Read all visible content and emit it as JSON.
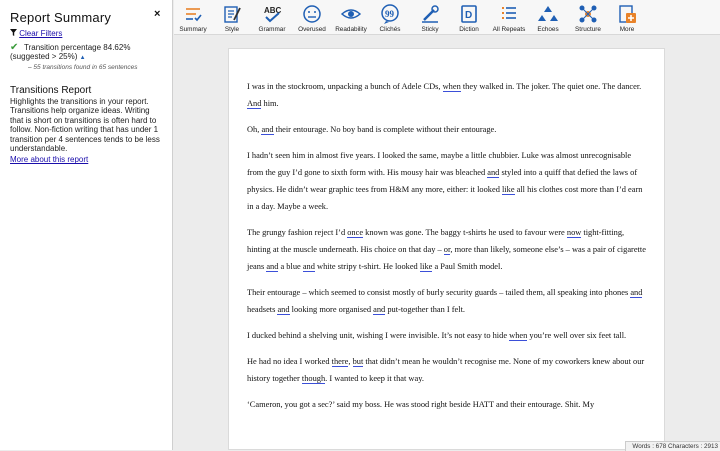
{
  "sidebar": {
    "title": "Report Summary",
    "close": "×",
    "filter_label": "Clear Filters",
    "result": "Transition percentage 84.62% (suggested > 25%)",
    "result_arrow": "▲",
    "result_note": "– 55 transitions found in 65 sentences",
    "heading": "Transitions Report",
    "description": "Highlights the transitions in your report. Transitions help organize ideas. Writing that is short on transitions is often hard to follow. Non-fiction writing that has under 1 transition per 4 sentences tends to be less understandable.",
    "more_link": "More about this report"
  },
  "toolbar": {
    "items": [
      {
        "label": "Summary",
        "icon": "summary-icon"
      },
      {
        "label": "Style",
        "icon": "style-icon"
      },
      {
        "label": "Grammar",
        "icon": "grammar-icon"
      },
      {
        "label": "Overused",
        "icon": "overused-icon"
      },
      {
        "label": "Readability",
        "icon": "readability-icon"
      },
      {
        "label": "Clichés",
        "icon": "cliches-icon"
      },
      {
        "label": "Sticky",
        "icon": "sticky-icon"
      },
      {
        "label": "Diction",
        "icon": "diction-icon"
      },
      {
        "label": "All Repeats",
        "icon": "all-repeats-icon"
      },
      {
        "label": "Echoes",
        "icon": "echoes-icon"
      },
      {
        "label": "Structure",
        "icon": "structure-icon"
      },
      {
        "label": "More",
        "icon": "more-icon"
      }
    ]
  },
  "document": {
    "paragraphs": [
      [
        [
          "I was in the stockroom, unpacking a bunch of Adele CDs, ",
          0
        ],
        [
          "when",
          1
        ],
        [
          " they walked in. The joker. The quiet one. The dancer. ",
          0
        ],
        [
          "And",
          1
        ],
        [
          " him.",
          0
        ]
      ],
      [
        [
          "Oh, ",
          0
        ],
        [
          "and",
          1
        ],
        [
          " their entourage. No boy band is complete without their entourage.",
          0
        ]
      ],
      [
        [
          "I hadn’t seen him in almost five years. I looked the same, maybe a little chubbier. Luke was almost unrecognisable from the guy I’d gone to sixth form with. His mousy hair was bleached ",
          0
        ],
        [
          "and",
          1
        ],
        [
          " styled into a quiff that defied the laws of physics. He didn’t wear graphic tees from H&M any more, either: it looked ",
          0
        ],
        [
          "like",
          1
        ],
        [
          " all his clothes cost more than I’d earn in a day. Maybe a week.",
          0
        ]
      ],
      [
        [
          "The grungy fashion reject I’d ",
          0
        ],
        [
          "once",
          1
        ],
        [
          " known was gone. The baggy t-shirts he used to favour were ",
          0
        ],
        [
          "now",
          1
        ],
        [
          " tight-fitting, hinting at the muscle underneath. His choice on that day – ",
          0
        ],
        [
          "or",
          1
        ],
        [
          ", more than likely, someone else’s – was a pair of cigarette jeans ",
          0
        ],
        [
          "and",
          1
        ],
        [
          " a blue ",
          0
        ],
        [
          "and",
          1
        ],
        [
          " white stripy t-shirt. He looked ",
          0
        ],
        [
          "like",
          1
        ],
        [
          " a Paul Smith model.",
          0
        ]
      ],
      [
        [
          "Their entourage – which seemed to consist mostly of burly security guards – tailed them, all speaking into phones ",
          0
        ],
        [
          "and",
          1
        ],
        [
          " headsets ",
          0
        ],
        [
          "and",
          1
        ],
        [
          " looking more organised ",
          0
        ],
        [
          "and",
          1
        ],
        [
          " put-together than I felt.",
          0
        ]
      ],
      [
        [
          "I ducked behind a shelving unit, wishing I were invisible. It’s not easy to hide ",
          0
        ],
        [
          "when",
          1
        ],
        [
          " you’re well over six feet tall.",
          0
        ]
      ],
      [
        [
          "He had no idea I worked ",
          0
        ],
        [
          "there",
          1
        ],
        [
          ", ",
          0
        ],
        [
          "but",
          1
        ],
        [
          " that didn’t mean he wouldn’t recognise me. None of my coworkers knew about our history together ",
          0
        ],
        [
          "though",
          1
        ],
        [
          ". I wanted to keep it that way.",
          0
        ]
      ],
      [
        [
          "‘Cameron, you got a sec?’ said my boss. He was stood right beside HATT and their entourage. Shit. My",
          0
        ]
      ]
    ]
  },
  "status": "Words : 678 Characters : 2913",
  "colors": {
    "accent": "#1f5fb4",
    "underline": "#3b4fd8",
    "check": "#3a9b3a"
  }
}
